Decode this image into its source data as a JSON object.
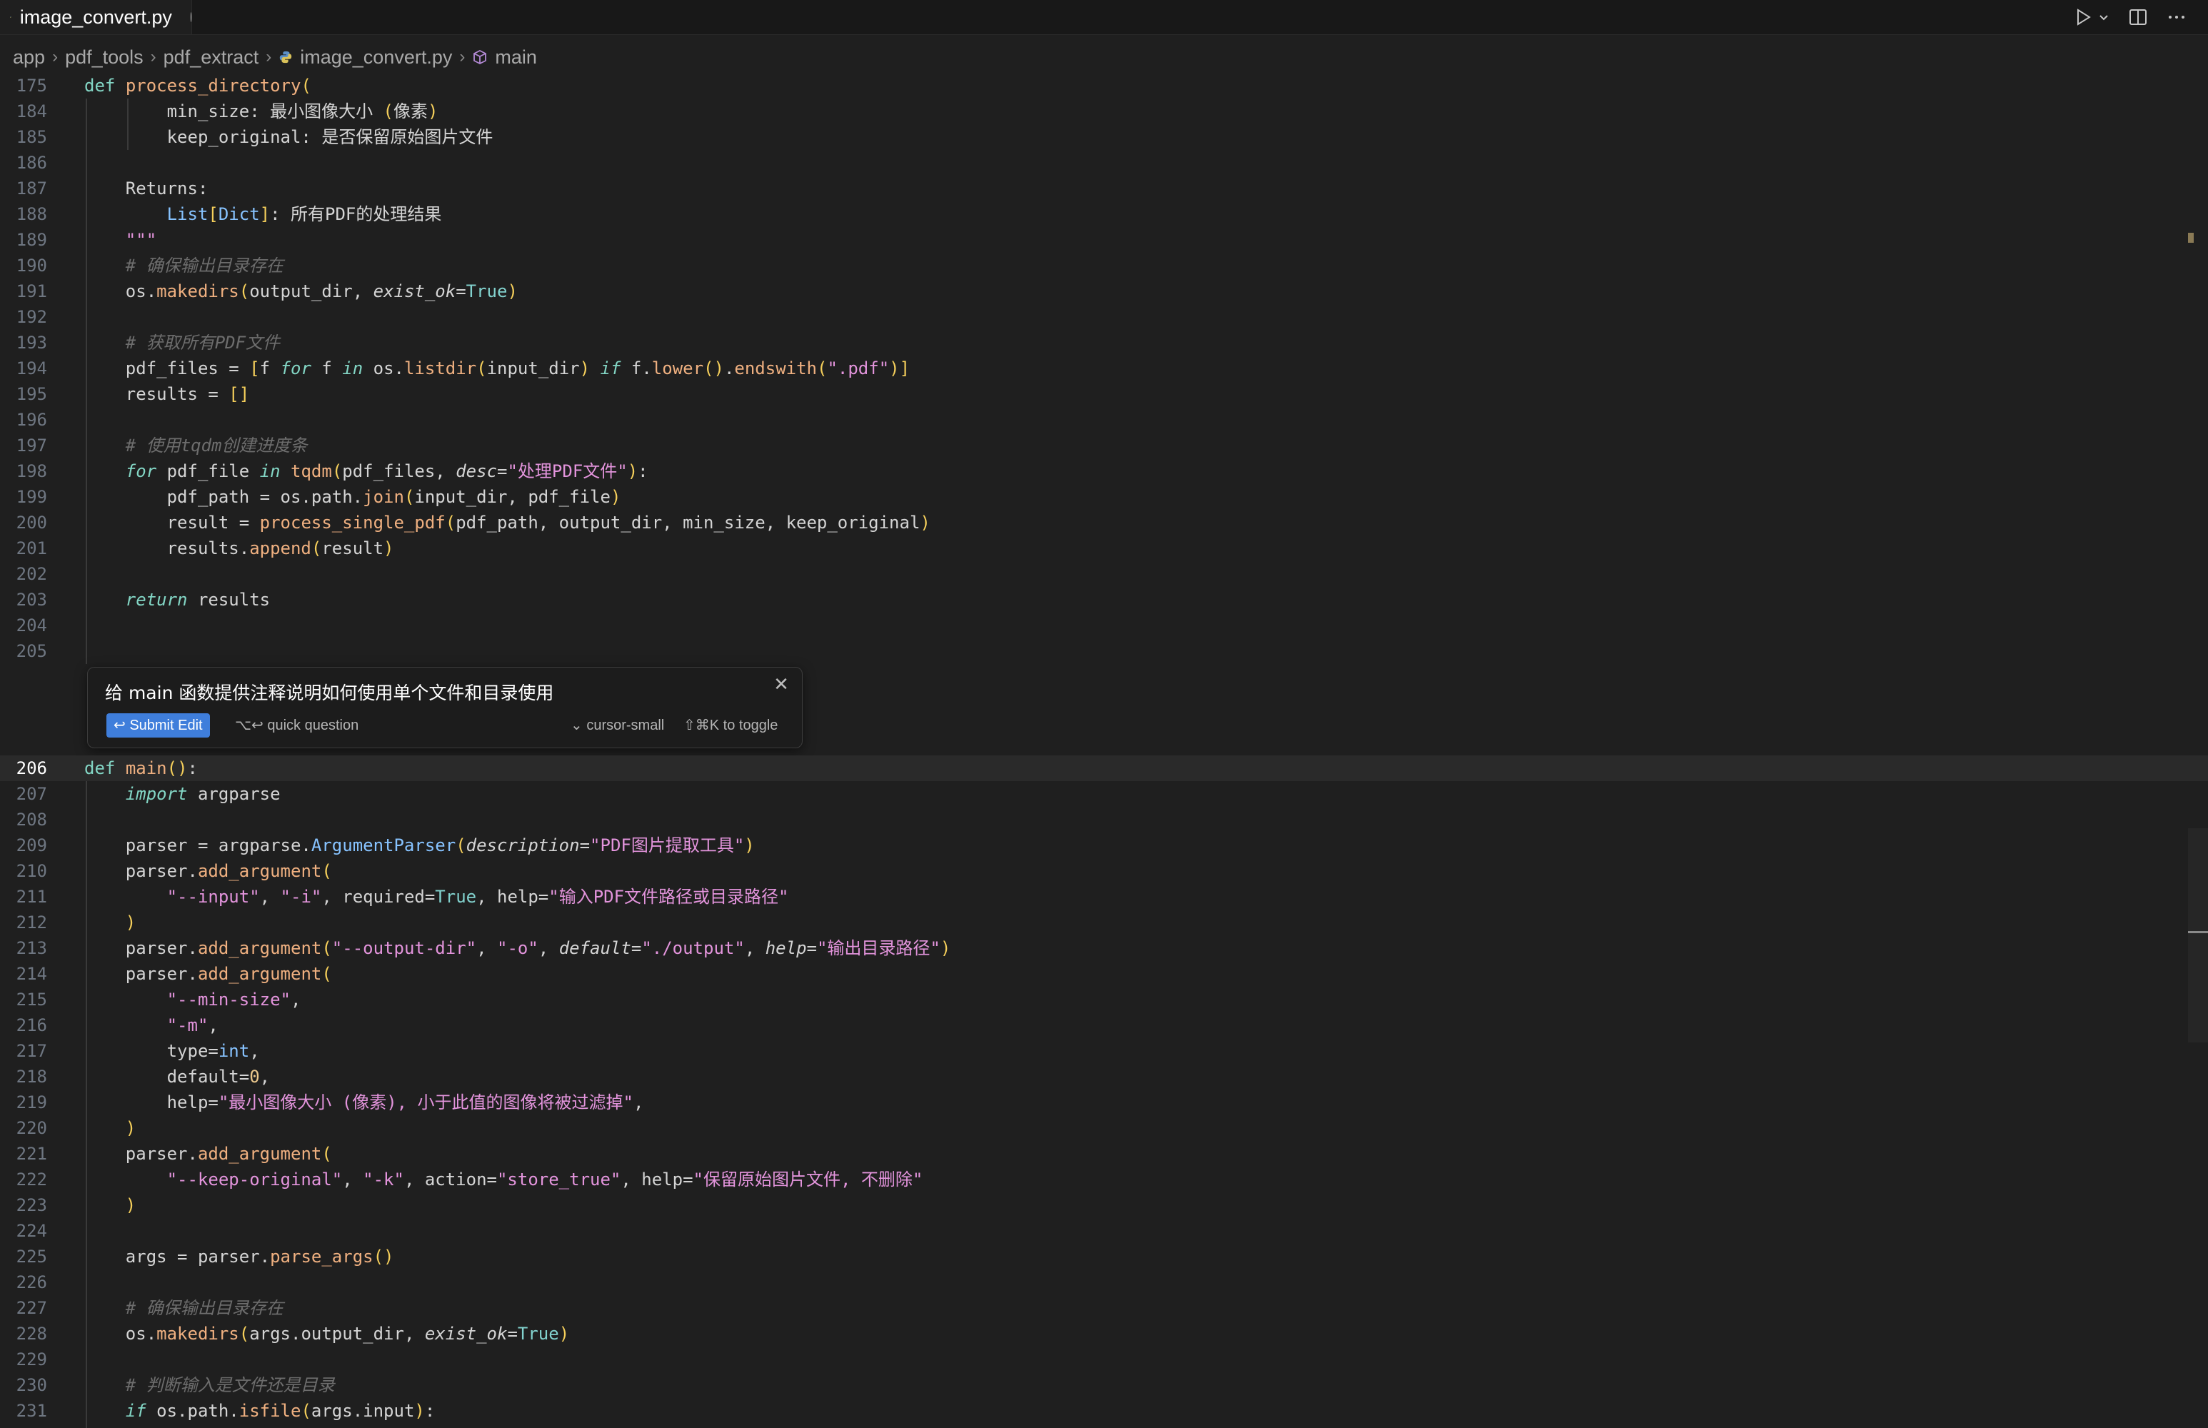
{
  "tab": {
    "title": "image_convert.py"
  },
  "breadcrumb": [
    "app",
    "pdf_tools",
    "pdf_extract",
    "image_convert.py",
    "main"
  ],
  "icons": {
    "run": "play-icon",
    "run_menu": "chevron-down-icon",
    "split": "split-editor-icon",
    "more": "ellipsis-icon",
    "file": "python-file-icon",
    "symbol": "cube-symbol-icon",
    "close": "close-icon"
  },
  "editor": {
    "current_line": "206",
    "top_lines": [
      {
        "n": "175",
        "t": "def process_directory("
      },
      {
        "n": "184",
        "t": "        min_size: 最小图像大小 (像素)"
      },
      {
        "n": "185",
        "t": "        keep_original: 是否保留原始图片文件"
      },
      {
        "n": "186",
        "t": ""
      },
      {
        "n": "187",
        "t": "    Returns:"
      },
      {
        "n": "188",
        "t": "        List[Dict]: 所有PDF的处理结果"
      },
      {
        "n": "189",
        "t": "    \"\"\""
      },
      {
        "n": "190",
        "t": "    # 确保输出目录存在"
      },
      {
        "n": "191",
        "t": "    os.makedirs(output_dir, exist_ok=True)"
      },
      {
        "n": "192",
        "t": ""
      },
      {
        "n": "193",
        "t": "    # 获取所有PDF文件"
      },
      {
        "n": "194",
        "t": "    pdf_files = [f for f in os.listdir(input_dir) if f.lower().endswith(\".pdf\")]"
      },
      {
        "n": "195",
        "t": "    results = []"
      },
      {
        "n": "196",
        "t": ""
      },
      {
        "n": "197",
        "t": "    # 使用tqdm创建进度条"
      },
      {
        "n": "198",
        "t": "    for pdf_file in tqdm(pdf_files, desc=\"处理PDF文件\"):"
      },
      {
        "n": "199",
        "t": "        pdf_path = os.path.join(input_dir, pdf_file)"
      },
      {
        "n": "200",
        "t": "        result = process_single_pdf(pdf_path, output_dir, min_size, keep_original)"
      },
      {
        "n": "201",
        "t": "        results.append(result)"
      },
      {
        "n": "202",
        "t": ""
      },
      {
        "n": "203",
        "t": "    return results"
      },
      {
        "n": "204",
        "t": ""
      },
      {
        "n": "205",
        "t": ""
      }
    ],
    "bottom_lines": [
      {
        "n": "206",
        "t": "def main():"
      },
      {
        "n": "207",
        "t": "    import argparse"
      },
      {
        "n": "208",
        "t": ""
      },
      {
        "n": "209",
        "t": "    parser = argparse.ArgumentParser(description=\"PDF图片提取工具\")"
      },
      {
        "n": "210",
        "t": "    parser.add_argument("
      },
      {
        "n": "211",
        "t": "        \"--input\", \"-i\", required=True, help=\"输入PDF文件路径或目录路径\""
      },
      {
        "n": "212",
        "t": "    )"
      },
      {
        "n": "213",
        "t": "    parser.add_argument(\"--output-dir\", \"-o\", default=\"./output\", help=\"输出目录路径\")"
      },
      {
        "n": "214",
        "t": "    parser.add_argument("
      },
      {
        "n": "215",
        "t": "        \"--min-size\","
      },
      {
        "n": "216",
        "t": "        \"-m\","
      },
      {
        "n": "217",
        "t": "        type=int,"
      },
      {
        "n": "218",
        "t": "        default=0,"
      },
      {
        "n": "219",
        "t": "        help=\"最小图像大小 (像素), 小于此值的图像将被过滤掉\","
      },
      {
        "n": "220",
        "t": "    )"
      },
      {
        "n": "221",
        "t": "    parser.add_argument("
      },
      {
        "n": "222",
        "t": "        \"--keep-original\", \"-k\", action=\"store_true\", help=\"保留原始图片文件, 不删除\""
      },
      {
        "n": "223",
        "t": "    )"
      },
      {
        "n": "224",
        "t": ""
      },
      {
        "n": "225",
        "t": "    args = parser.parse_args()"
      },
      {
        "n": "226",
        "t": ""
      },
      {
        "n": "227",
        "t": "    # 确保输出目录存在"
      },
      {
        "n": "228",
        "t": "    os.makedirs(args.output_dir, exist_ok=True)"
      },
      {
        "n": "229",
        "t": ""
      },
      {
        "n": "230",
        "t": "    # 判断输入是文件还是目录"
      },
      {
        "n": "231",
        "t": "    if os.path.isfile(args.input):"
      }
    ]
  },
  "inline_edit": {
    "prompt_value": "给 main 函数提供注释说明如何使用单个文件和目录使用",
    "submit_label": "↩ Submit Edit",
    "quick_question": "⌥↩ quick question",
    "model": "⌄ cursor-small",
    "toggle": "⇧⌘K to toggle"
  },
  "colors": {
    "background": "#1f1f1f",
    "keyword": "#83d6c5",
    "function": "#efb080",
    "string": "#e394dc",
    "comment": "#6d6d6d",
    "accent": "#3f7edb"
  }
}
